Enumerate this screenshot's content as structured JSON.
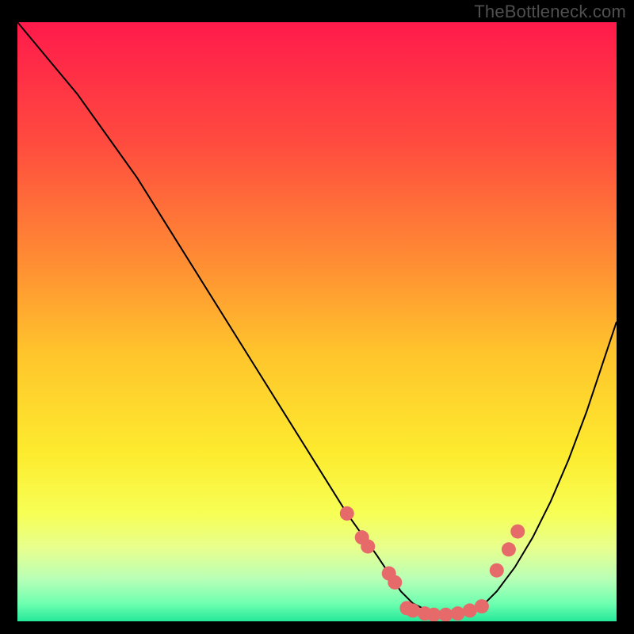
{
  "watermark": "TheBottleneck.com",
  "chart_data": {
    "type": "line",
    "title": "",
    "xlabel": "",
    "ylabel": "",
    "xlim": [
      0,
      100
    ],
    "ylim": [
      0,
      100
    ],
    "grid": false,
    "legend": false,
    "background_gradient": {
      "stops": [
        {
          "pos": 0.0,
          "color": "#ff1a4b"
        },
        {
          "pos": 0.2,
          "color": "#ff4b3f"
        },
        {
          "pos": 0.4,
          "color": "#ff8d33"
        },
        {
          "pos": 0.55,
          "color": "#ffc42c"
        },
        {
          "pos": 0.72,
          "color": "#fdeb2e"
        },
        {
          "pos": 0.82,
          "color": "#f7ff55"
        },
        {
          "pos": 0.88,
          "color": "#e6ff90"
        },
        {
          "pos": 0.93,
          "color": "#b7ffb7"
        },
        {
          "pos": 0.97,
          "color": "#6fffb0"
        },
        {
          "pos": 1.0,
          "color": "#26e89a"
        }
      ]
    },
    "series": [
      {
        "name": "bottleneck-curve",
        "color": "#000000",
        "x": [
          0,
          5,
          10,
          15,
          20,
          25,
          30,
          35,
          40,
          45,
          50,
          55,
          60,
          62,
          64,
          66,
          68,
          70,
          72,
          74,
          76,
          78,
          80,
          83,
          86,
          89,
          92,
          95,
          98,
          100
        ],
        "y": [
          100,
          94,
          88,
          81,
          74,
          66,
          58,
          50,
          42,
          34,
          26,
          18,
          11,
          8,
          5,
          3,
          2,
          1,
          1,
          1,
          2,
          3,
          5,
          9,
          14,
          20,
          27,
          35,
          44,
          50
        ]
      }
    ],
    "markers": {
      "name": "highlight-dots",
      "color": "#e66a6a",
      "radius": 9,
      "points": [
        {
          "x": 55.0,
          "y": 18.0
        },
        {
          "x": 57.5,
          "y": 14.0
        },
        {
          "x": 58.5,
          "y": 12.5
        },
        {
          "x": 62.0,
          "y": 8.0
        },
        {
          "x": 63.0,
          "y": 6.5
        },
        {
          "x": 65.0,
          "y": 2.2
        },
        {
          "x": 66.0,
          "y": 1.8
        },
        {
          "x": 68.0,
          "y": 1.3
        },
        {
          "x": 69.5,
          "y": 1.1
        },
        {
          "x": 71.5,
          "y": 1.1
        },
        {
          "x": 73.5,
          "y": 1.3
        },
        {
          "x": 75.5,
          "y": 1.8
        },
        {
          "x": 77.5,
          "y": 2.5
        },
        {
          "x": 80.0,
          "y": 8.5
        },
        {
          "x": 82.0,
          "y": 12.0
        },
        {
          "x": 83.5,
          "y": 15.0
        }
      ]
    }
  }
}
